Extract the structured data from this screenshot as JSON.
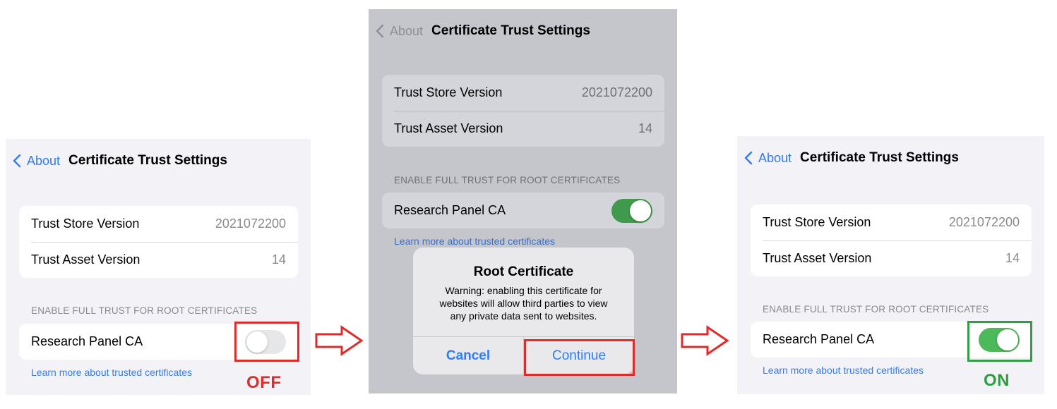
{
  "screens": [
    {
      "nav": {
        "back_label": "About",
        "title": "Certificate Trust Settings"
      },
      "info_rows": [
        {
          "label": "Trust Store Version",
          "value": "2021072200"
        },
        {
          "label": "Trust Asset Version",
          "value": "14"
        }
      ],
      "section_header": "ENABLE FULL TRUST FOR ROOT CERTIFICATES",
      "cert_row": {
        "label": "Research Panel CA",
        "toggle_on": false
      },
      "link": "Learn more about trusted certificates"
    },
    {
      "nav": {
        "back_label": "About",
        "title": "Certificate Trust Settings"
      },
      "info_rows": [
        {
          "label": "Trust Store Version",
          "value": "2021072200"
        },
        {
          "label": "Trust Asset Version",
          "value": "14"
        }
      ],
      "section_header": "ENABLE FULL TRUST FOR ROOT CERTIFICATES",
      "cert_row": {
        "label": "Research Panel CA",
        "toggle_on": true
      },
      "link": "Learn more about trusted certificates",
      "alert": {
        "title": "Root Certificate",
        "message": "Warning: enabling this certificate for websites will allow third parties to view any private data sent to websites.",
        "cancel_label": "Cancel",
        "continue_label": "Continue"
      }
    },
    {
      "nav": {
        "back_label": "About",
        "title": "Certificate Trust Settings"
      },
      "info_rows": [
        {
          "label": "Trust Store Version",
          "value": "2021072200"
        },
        {
          "label": "Trust Asset Version",
          "value": "14"
        }
      ],
      "section_header": "ENABLE FULL TRUST FOR ROOT CERTIFICATES",
      "cert_row": {
        "label": "Research Panel CA",
        "toggle_on": true
      },
      "link": "Learn more about trusted certificates"
    }
  ],
  "annotations": {
    "off_label": "OFF",
    "on_label": "ON"
  },
  "colors": {
    "accent_blue": "#2f7cf6",
    "highlight_red": "#e02b2b",
    "highlight_green": "#2ea043",
    "toggle_on_green": "#4cb95a"
  },
  "icons": {
    "back": "chevron-left-icon",
    "step": "arrow-right-icon"
  }
}
